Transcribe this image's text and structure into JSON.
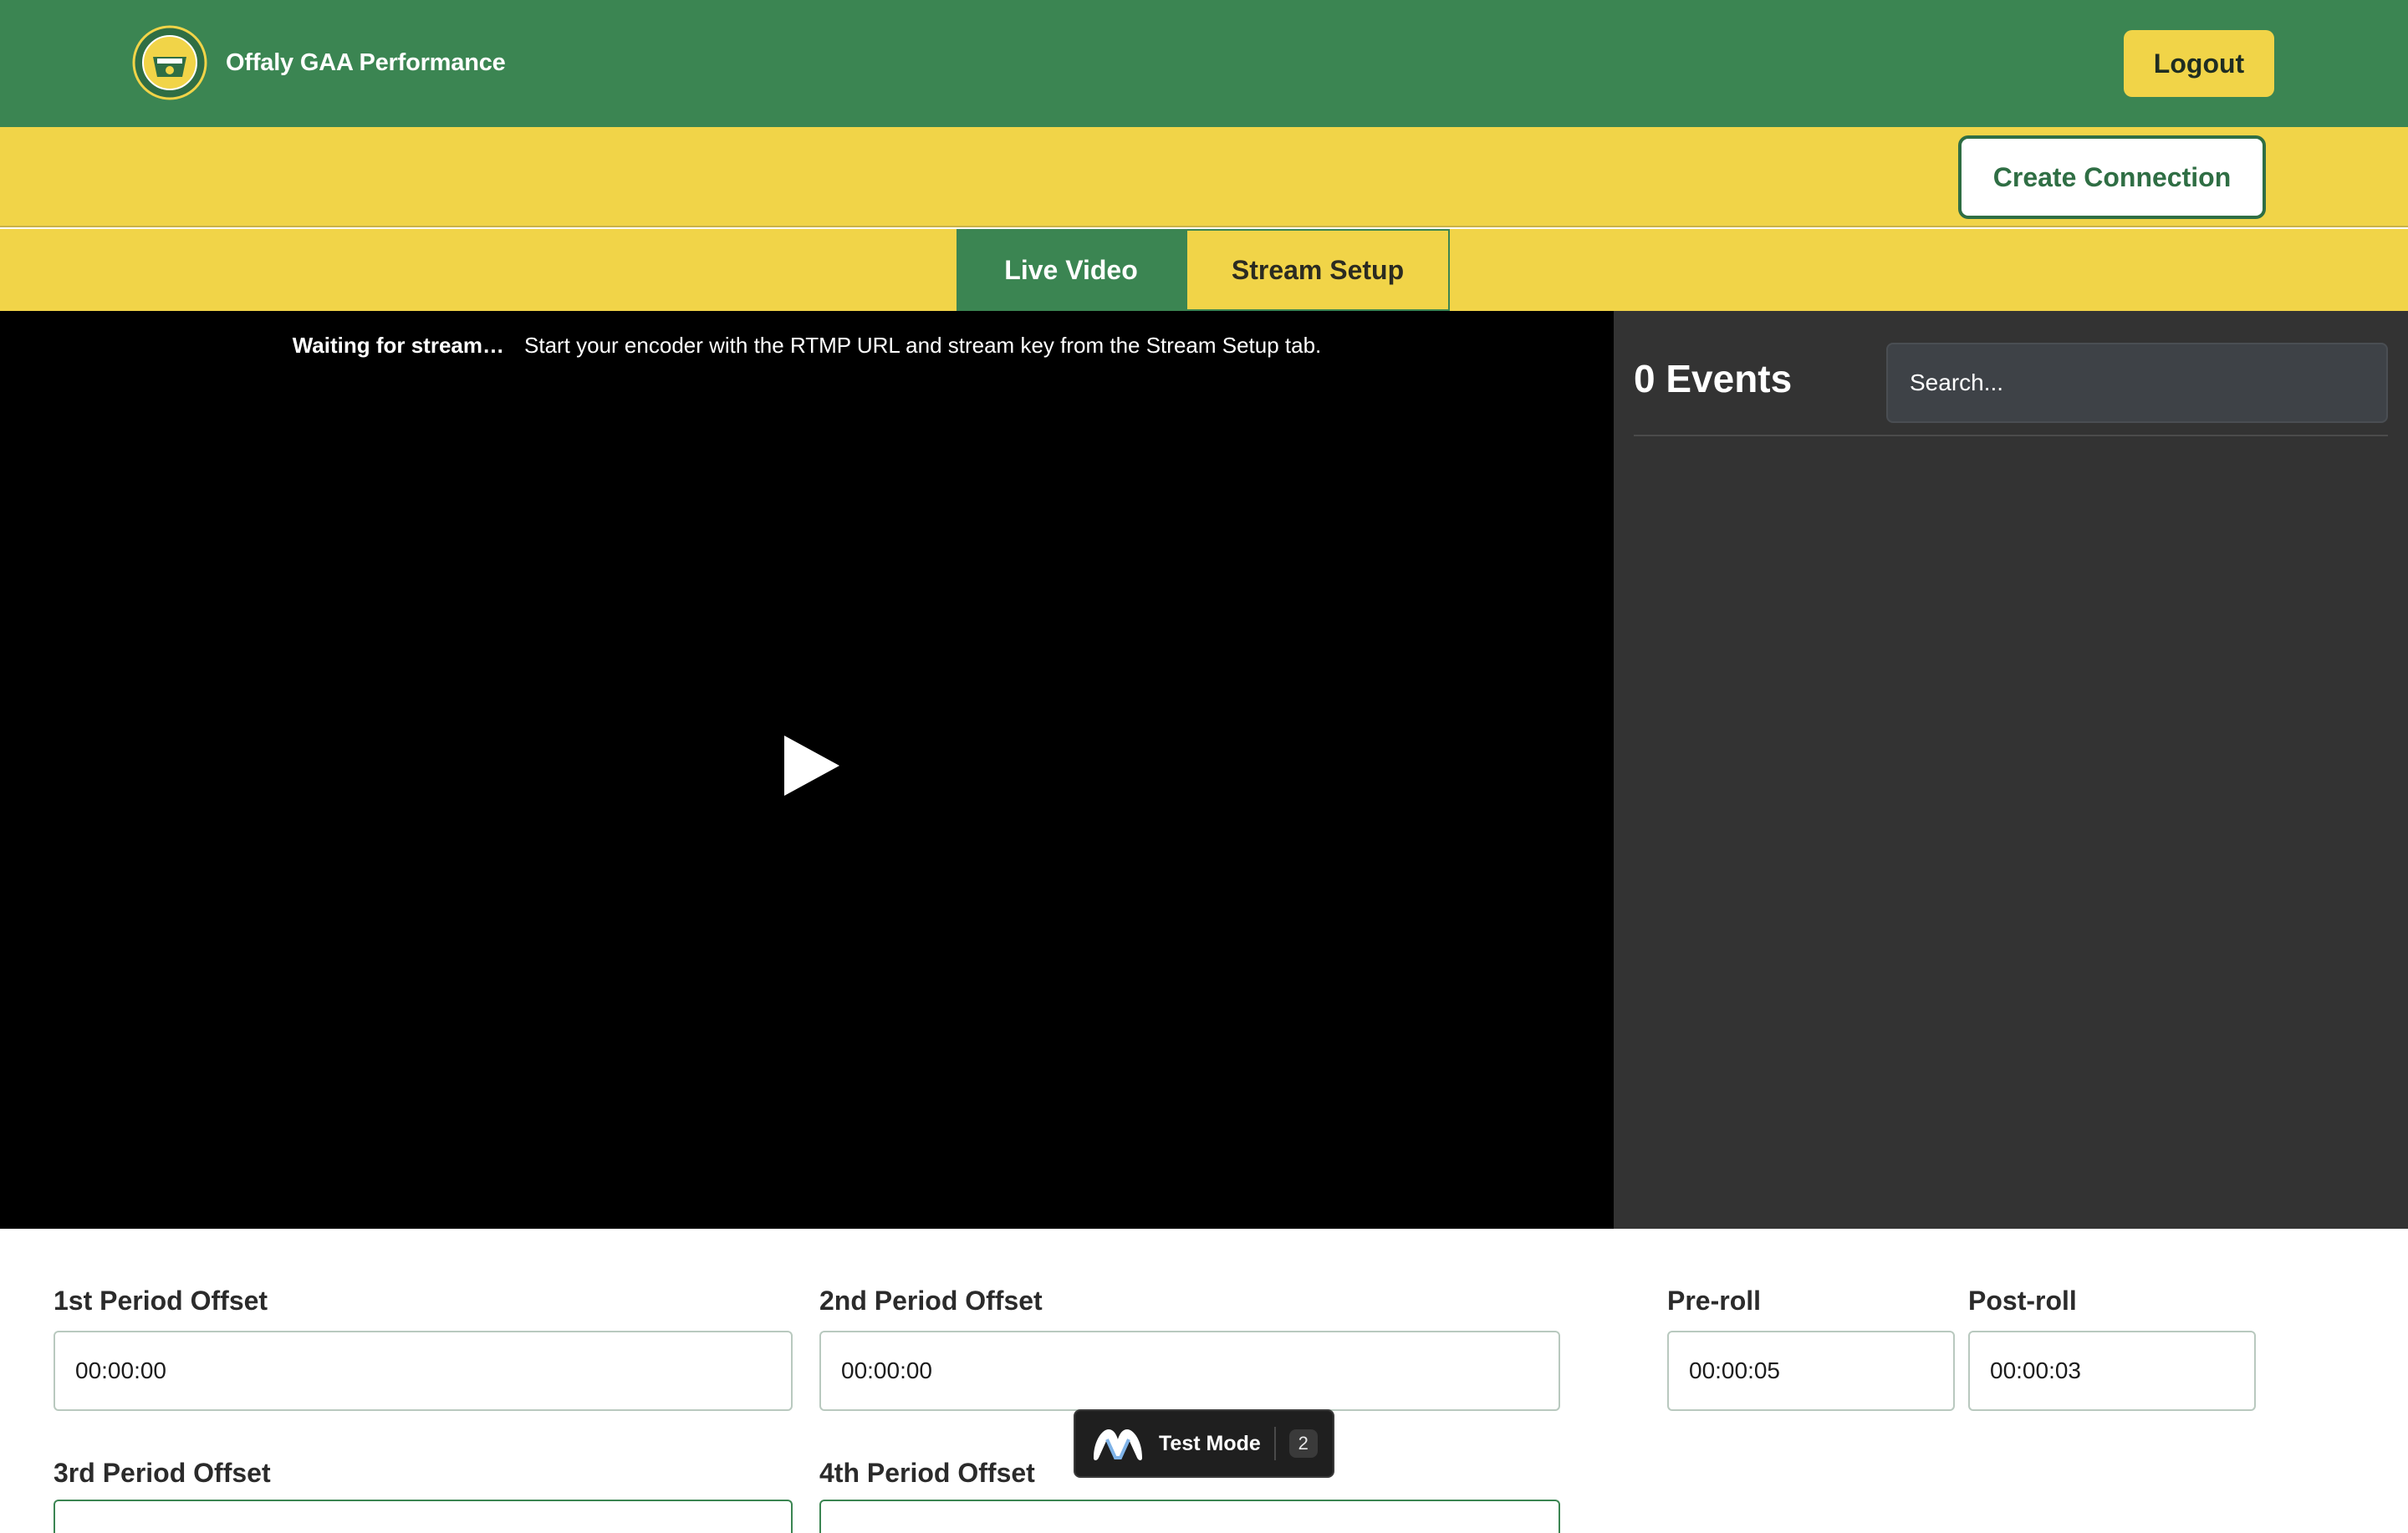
{
  "header": {
    "brand_name": "Offaly GAA Performance",
    "logout_label": "Logout"
  },
  "actions": {
    "create_connection_label": "Create Connection"
  },
  "tabs": [
    {
      "label": "Live Video",
      "active": true
    },
    {
      "label": "Stream Setup",
      "active": false
    }
  ],
  "video": {
    "status_title": "Waiting for stream…",
    "status_message": "Start your encoder with the RTMP URL and stream key from the Stream Setup tab."
  },
  "events": {
    "count_label": "0 Events",
    "search_placeholder": "Search..."
  },
  "form": {
    "first_period": {
      "label": "1st Period Offset",
      "value": "00:00:00"
    },
    "second_period": {
      "label": "2nd Period Offset",
      "value": "00:00:00"
    },
    "pre_roll": {
      "label": "Pre-roll",
      "value": "00:00:05"
    },
    "post_roll": {
      "label": "Post-roll",
      "value": "00:00:03"
    },
    "third_period": {
      "label": "3rd Period Offset"
    },
    "fourth_period": {
      "label": "4th Period Offset"
    }
  },
  "toast": {
    "label": "Test Mode",
    "badge": "2"
  },
  "colors": {
    "brand_green": "#3b8552",
    "brand_yellow": "#f1d448",
    "panel_dark": "#333333"
  }
}
